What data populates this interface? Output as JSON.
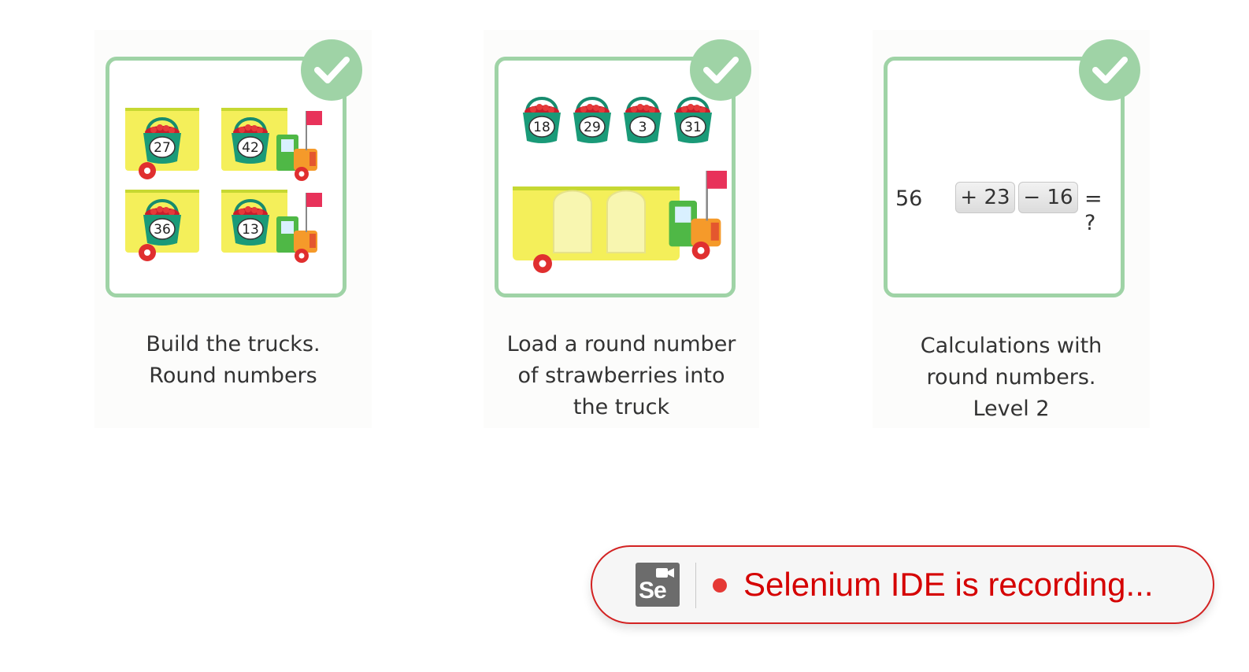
{
  "cards": [
    {
      "title": "Build the trucks.\nRound numbers",
      "completed": true,
      "basket_numbers": [
        "27",
        "42",
        "36",
        "13"
      ]
    },
    {
      "title": "Load a round number\nof strawberries into\nthe truck",
      "completed": true,
      "basket_numbers": [
        "18",
        "29",
        "3",
        "31"
      ]
    },
    {
      "title": "Calculations with\nround numbers.\nLevel 2",
      "completed": true,
      "equation": {
        "start": "56",
        "op1": "+ 23",
        "op2": "− 16",
        "end": "= ?"
      }
    }
  ],
  "recording_banner": {
    "logo_text": "Se",
    "text": "Selenium IDE is recording..."
  },
  "colors": {
    "frame": "#9fd3a6",
    "truck_body": "#f4ef5a",
    "basket": "#1a9a78",
    "flag": "#e8325a",
    "recording_red": "#d50000"
  },
  "icons": [
    "check-icon",
    "basket-icon",
    "truck-icon",
    "flag-icon",
    "camera-icon",
    "record-dot-icon"
  ]
}
